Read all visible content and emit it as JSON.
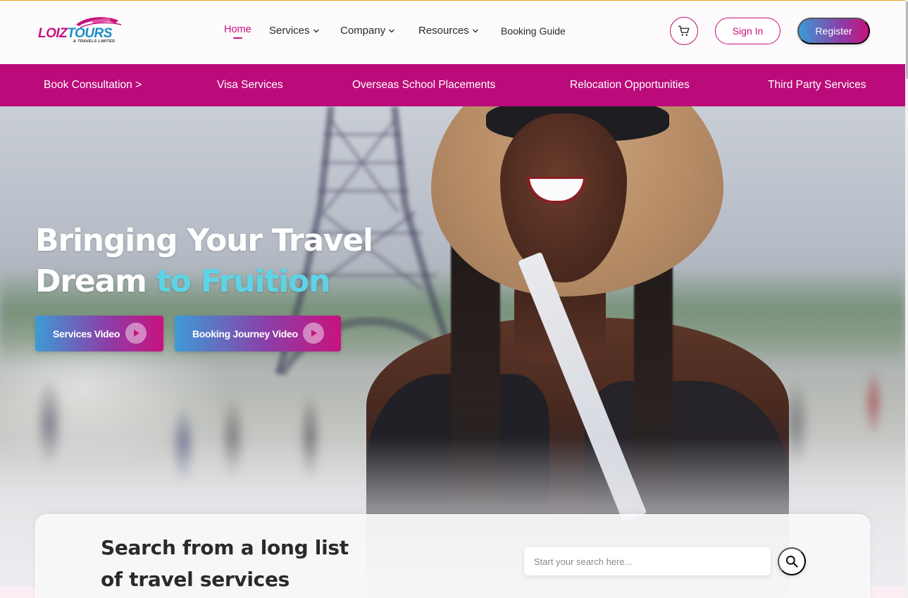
{
  "brand": {
    "logo_word_1": "LOIZ",
    "logo_word_2": "TOURS",
    "logo_tagline": "& TRAVELS LIMITED",
    "primary_color": "#c8127e",
    "secondary_color": "#1c8ec8",
    "accent_teal": "#5fd3e6"
  },
  "nav": {
    "items": [
      {
        "label": "Home",
        "active": true,
        "dropdown": false
      },
      {
        "label": "Services",
        "active": false,
        "dropdown": true
      },
      {
        "label": "Company",
        "active": false,
        "dropdown": true
      },
      {
        "label": "Resources",
        "active": false,
        "dropdown": true
      },
      {
        "label": "Booking Guide",
        "active": false,
        "dropdown": false
      }
    ],
    "cart_icon": "cart-icon",
    "signin_label": "Sign In",
    "register_label": "Register"
  },
  "subnav": {
    "items": [
      {
        "label": "Book Consultation >"
      },
      {
        "label": "Visa Services"
      },
      {
        "label": "Overseas School Placements"
      },
      {
        "label": "Relocation Opportunities"
      },
      {
        "label": "Third Party Services"
      }
    ]
  },
  "hero": {
    "title_line_1": "Bringing Your Travel",
    "title_line_2_plain": "Dream ",
    "title_line_2_accent": "to Fruition",
    "buttons": [
      {
        "label": "Services Video",
        "icon": "play-icon"
      },
      {
        "label": "Booking Journey Video",
        "icon": "play-icon"
      }
    ]
  },
  "search": {
    "heading_line_1": "Search from a long list",
    "heading_line_2": "of travel services",
    "placeholder": "Start your search here...",
    "value": "",
    "icon": "search-icon"
  }
}
